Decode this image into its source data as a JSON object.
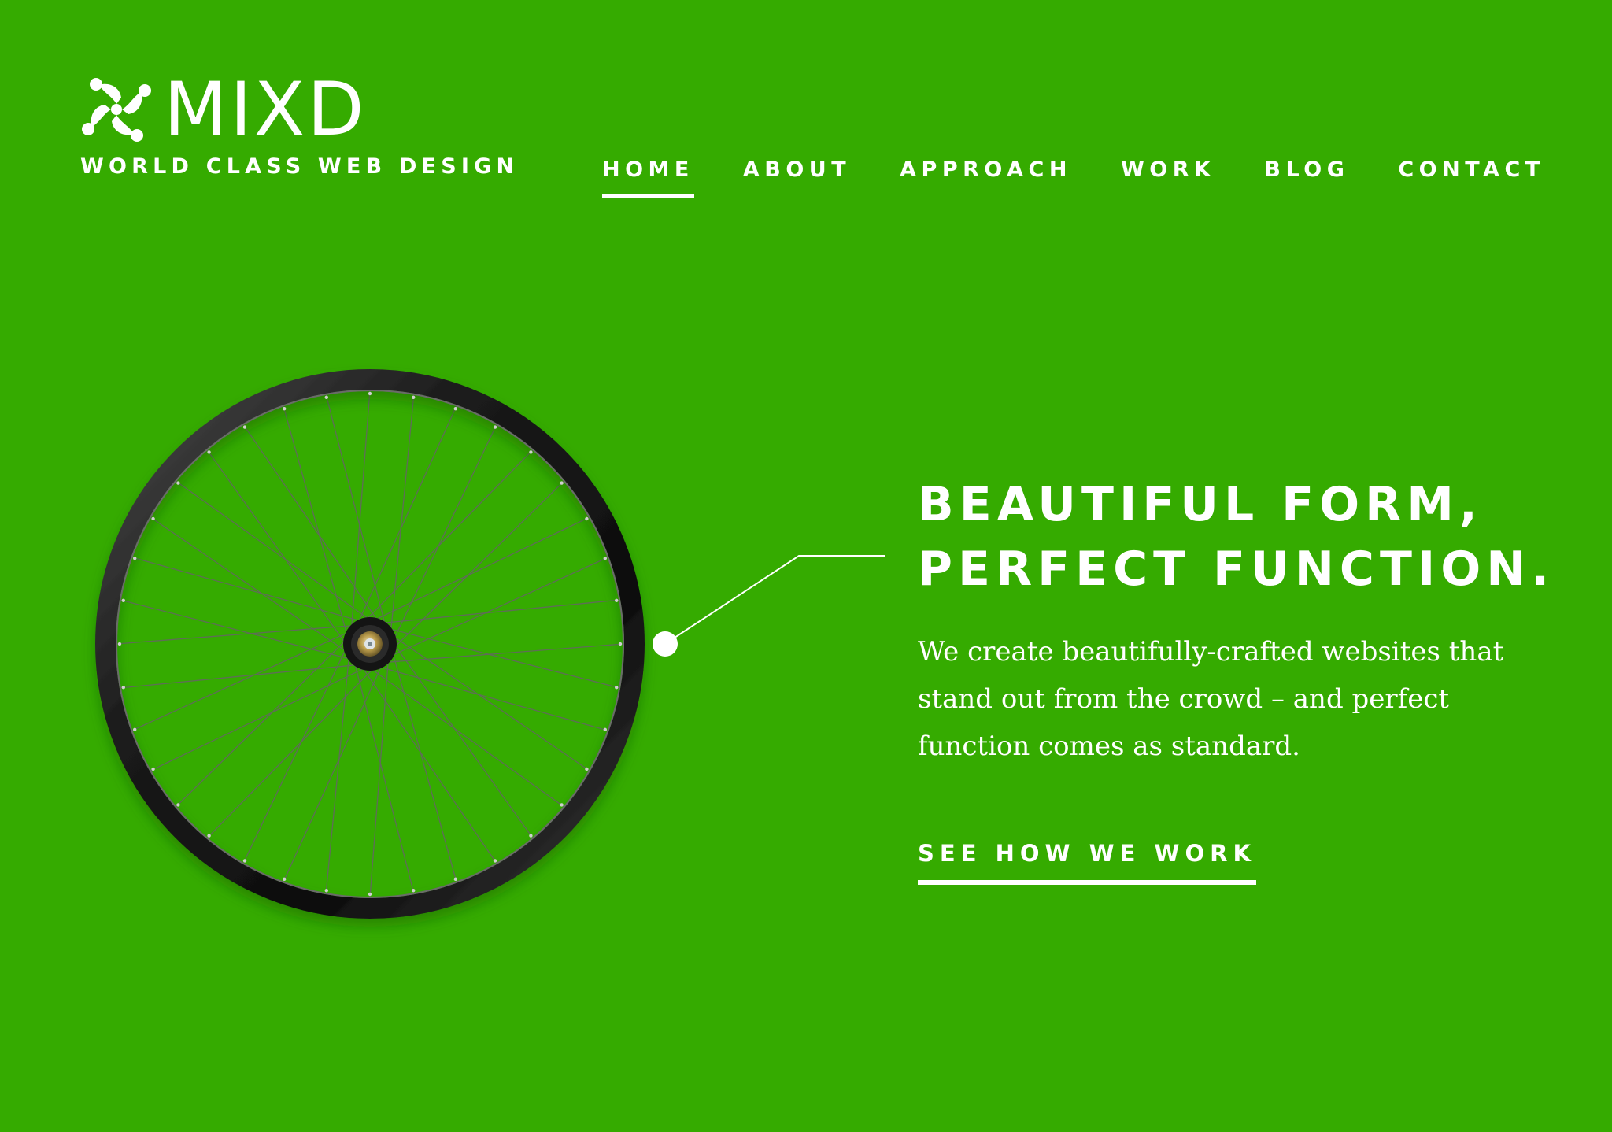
{
  "brand": {
    "name": "MIXD",
    "tagline": "WORLD CLASS WEB DESIGN",
    "logo_icon": "pinwheel-logo-icon"
  },
  "nav": {
    "items": [
      {
        "label": "HOME",
        "active": true
      },
      {
        "label": "ABOUT",
        "active": false
      },
      {
        "label": "APPROACH",
        "active": false
      },
      {
        "label": "WORK",
        "active": false
      },
      {
        "label": "BLOG",
        "active": false
      },
      {
        "label": "CONTACT",
        "active": false
      }
    ]
  },
  "hero": {
    "title_line1": "BEAUTIFUL FORM,",
    "title_line2": "PERFECT FUNCTION.",
    "body": "We create beautifully-crafted websites that stand out from the crowd – and perfect function comes as standard.",
    "cta_label": "SEE HOW WE WORK",
    "image": "bicycle-wheel-illustration"
  },
  "colors": {
    "background": "#35ab00",
    "text": "#ffffff"
  }
}
